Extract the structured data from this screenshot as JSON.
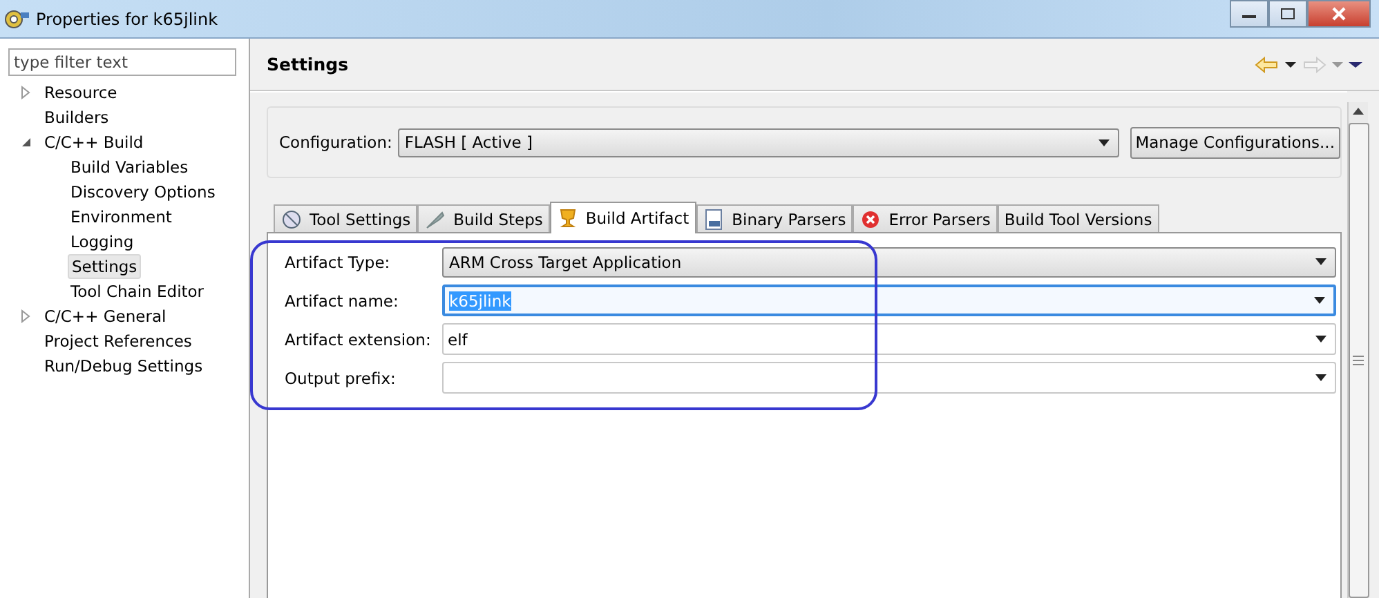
{
  "window": {
    "title": "Properties for k65jlink"
  },
  "filter": {
    "placeholder": "type filter text"
  },
  "tree": [
    {
      "label": "Resource",
      "expanded": false,
      "selected": false
    },
    {
      "label": "Builders",
      "selected": false
    },
    {
      "label": "C/C++ Build",
      "expanded": true,
      "selected": false,
      "children": [
        {
          "label": "Build Variables",
          "selected": false
        },
        {
          "label": "Discovery Options",
          "selected": false
        },
        {
          "label": "Environment",
          "selected": false
        },
        {
          "label": "Logging",
          "selected": false
        },
        {
          "label": "Settings",
          "selected": true
        },
        {
          "label": "Tool Chain Editor",
          "selected": false
        }
      ]
    },
    {
      "label": "C/C++ General",
      "expanded": false,
      "selected": false
    },
    {
      "label": "Project References",
      "selected": false
    },
    {
      "label": "Run/Debug Settings",
      "selected": false
    }
  ],
  "page_title": "Settings",
  "configuration": {
    "label": "Configuration:",
    "value": "FLASH  [ Active ]",
    "button": "Manage Configurations..."
  },
  "tabs": [
    {
      "label": "Tool Settings",
      "selected": false
    },
    {
      "label": "Build Steps",
      "selected": false
    },
    {
      "label": "Build Artifact",
      "selected": true
    },
    {
      "label": "Binary Parsers",
      "selected": false
    },
    {
      "label": "Error Parsers",
      "selected": false
    },
    {
      "label": "Build Tool Versions",
      "selected": false
    }
  ],
  "fields": [
    {
      "label": "Artifact Type:",
      "kind": "select",
      "value": "ARM Cross Target Application"
    },
    {
      "label": "Artifact name:",
      "kind": "combo",
      "value": "k65jlink",
      "focused": true
    },
    {
      "label": "Artifact extension:",
      "kind": "combo",
      "value": "elf",
      "focused": false
    },
    {
      "label": "Output prefix:",
      "kind": "combo",
      "focused": false
    }
  ]
}
